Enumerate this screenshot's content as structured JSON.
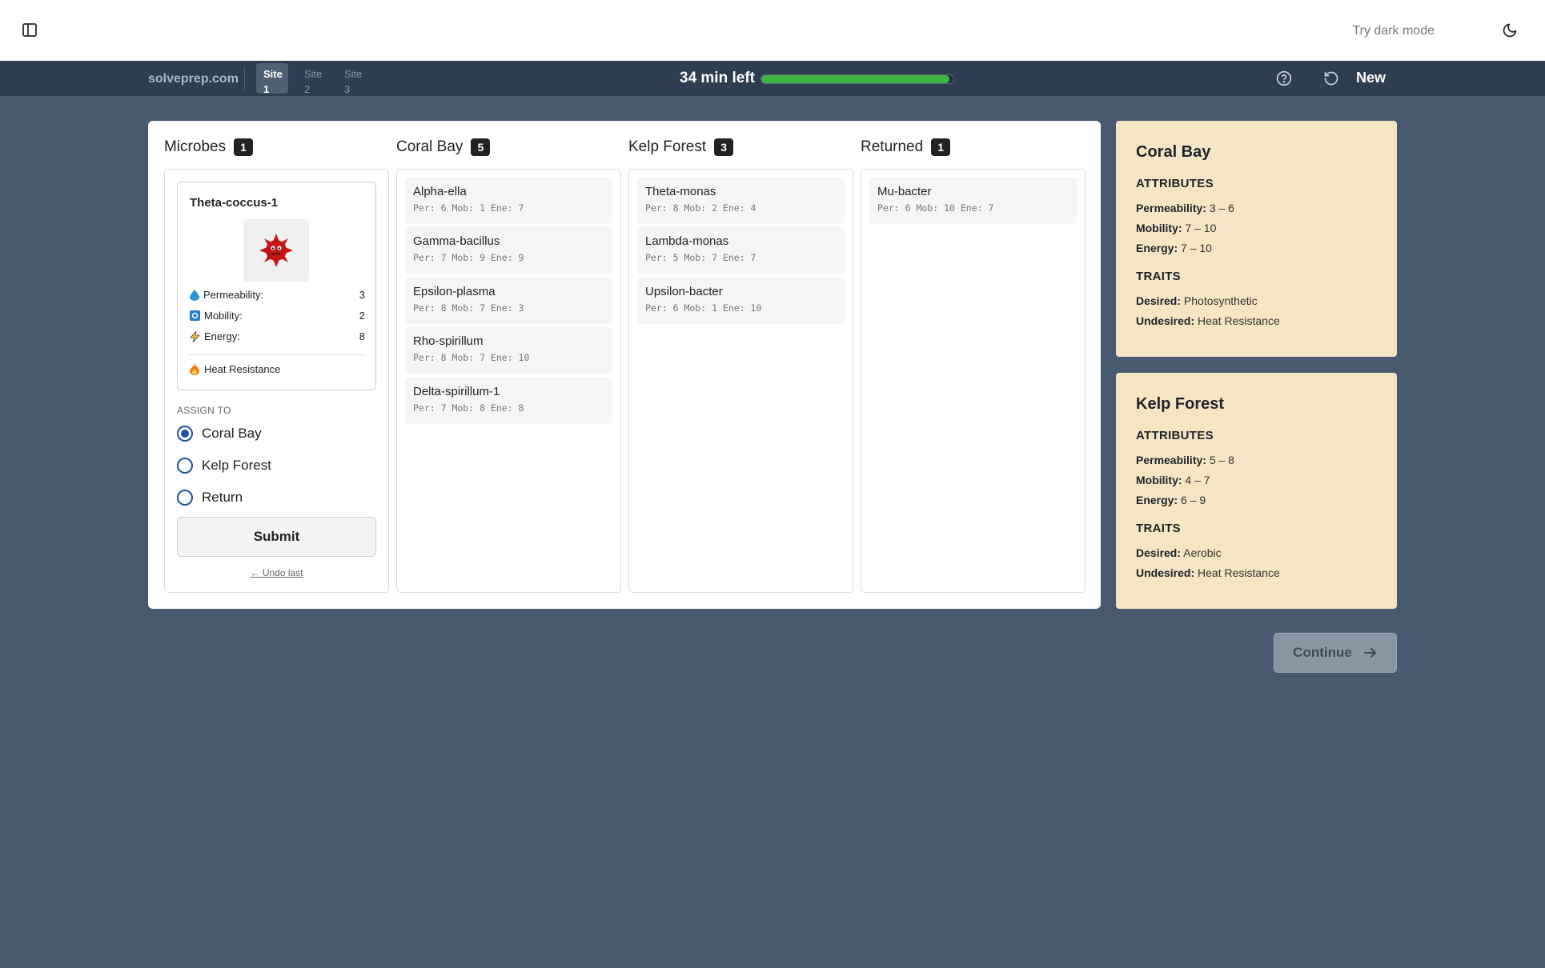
{
  "topbar": {
    "dark_mode_label": "Try dark mode"
  },
  "navbar": {
    "brand": "solveprep.com",
    "site_tabs": [
      {
        "line1": "Site",
        "line2": "1",
        "active": true
      },
      {
        "line1": "Site",
        "line2": "2",
        "active": false
      },
      {
        "line1": "Site",
        "line2": "3",
        "active": false
      }
    ],
    "timer": "34 min left",
    "progress_fraction": 0.98,
    "new_label": "New",
    "colors": {
      "progress": "#40b543",
      "navbar": "#2c3e50"
    }
  },
  "columns": {
    "microbes": {
      "title": "Microbes",
      "count": "1"
    },
    "coral_bay": {
      "title": "Coral Bay",
      "count": "5",
      "items": [
        {
          "name": "Alpha-ella",
          "stats": "Per: 6  Mob: 1  Ene: 7"
        },
        {
          "name": "Gamma-bacillus",
          "stats": "Per: 7  Mob: 9  Ene: 9"
        },
        {
          "name": "Epsilon-plasma",
          "stats": "Per: 8  Mob: 7  Ene: 3"
        },
        {
          "name": "Rho-spirillum",
          "stats": "Per: 8  Mob: 7  Ene: 10"
        },
        {
          "name": "Delta-spirillum-1",
          "stats": "Per: 7  Mob: 8  Ene: 8"
        }
      ]
    },
    "kelp_forest": {
      "title": "Kelp Forest",
      "count": "3",
      "items": [
        {
          "name": "Theta-monas",
          "stats": "Per: 8  Mob: 2  Ene: 4"
        },
        {
          "name": "Lambda-monas",
          "stats": "Per: 5  Mob: 7  Ene: 7"
        },
        {
          "name": "Upsilon-bacter",
          "stats": "Per: 6  Mob: 1  Ene: 10"
        }
      ]
    },
    "returned": {
      "title": "Returned",
      "count": "1",
      "items": [
        {
          "name": "Mu-bacter",
          "stats": "Per: 6  Mob: 10  Ene: 7"
        }
      ]
    }
  },
  "microbe": {
    "name": "Theta-coccus-1",
    "icon": "red-spiky-microbe",
    "attributes": [
      {
        "label": "Permeability:",
        "value": "3",
        "icon": "water-drop-icon"
      },
      {
        "label": "Mobility:",
        "value": "2",
        "icon": "mobility-icon"
      },
      {
        "label": "Energy:",
        "value": "8",
        "icon": "lightning-icon"
      }
    ],
    "trait": "Heat Resistance",
    "trait_icon": "fire-icon"
  },
  "assign": {
    "label": "ASSIGN TO",
    "options": [
      {
        "label": "Coral Bay",
        "checked": true
      },
      {
        "label": "Kelp Forest",
        "checked": false
      },
      {
        "label": "Return",
        "checked": false
      }
    ],
    "submit_label": "Submit",
    "undo_label": "← Undo last"
  },
  "site_cards": [
    {
      "title": "Coral Bay",
      "attributes_heading": "ATTRIBUTES",
      "perm_label": "Permeability:",
      "perm_value": "3 – 6",
      "mob_label": "Mobility:",
      "mob_value": "7 – 10",
      "ene_label": "Energy:",
      "ene_value": "7 – 10",
      "traits_heading": "TRAITS",
      "desired_label": "Desired:",
      "desired_value": "Photosynthetic",
      "undesired_label": "Undesired:",
      "undesired_value": "Heat Resistance"
    },
    {
      "title": "Kelp Forest",
      "attributes_heading": "ATTRIBUTES",
      "perm_label": "Permeability:",
      "perm_value": "5 – 8",
      "mob_label": "Mobility:",
      "mob_value": "4 – 7",
      "ene_label": "Energy:",
      "ene_value": "6 – 9",
      "traits_heading": "TRAITS",
      "desired_label": "Desired:",
      "desired_value": "Aerobic",
      "undesired_label": "Undesired:",
      "undesired_value": "Heat Resistance"
    }
  ],
  "continue_label": "Continue"
}
